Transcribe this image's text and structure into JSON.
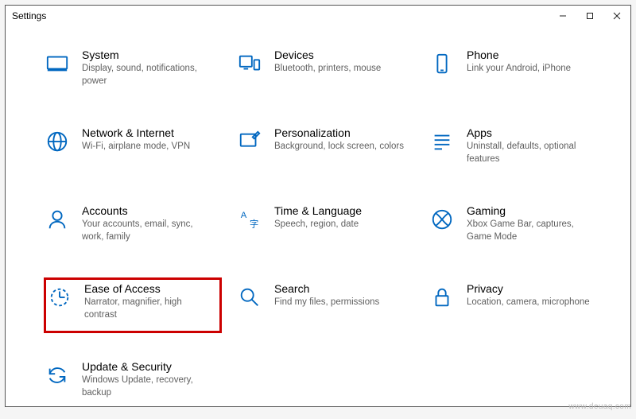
{
  "window": {
    "title": "Settings"
  },
  "tiles": [
    {
      "key": "system",
      "title": "System",
      "desc": "Display, sound, notifications, power"
    },
    {
      "key": "devices",
      "title": "Devices",
      "desc": "Bluetooth, printers, mouse"
    },
    {
      "key": "phone",
      "title": "Phone",
      "desc": "Link your Android, iPhone"
    },
    {
      "key": "network",
      "title": "Network & Internet",
      "desc": "Wi-Fi, airplane mode, VPN"
    },
    {
      "key": "personalization",
      "title": "Personalization",
      "desc": "Background, lock screen, colors"
    },
    {
      "key": "apps",
      "title": "Apps",
      "desc": "Uninstall, defaults, optional features"
    },
    {
      "key": "accounts",
      "title": "Accounts",
      "desc": "Your accounts, email, sync, work, family"
    },
    {
      "key": "timelang",
      "title": "Time & Language",
      "desc": "Speech, region, date"
    },
    {
      "key": "gaming",
      "title": "Gaming",
      "desc": "Xbox Game Bar, captures, Game Mode"
    },
    {
      "key": "ease",
      "title": "Ease of Access",
      "desc": "Narrator, magnifier, high contrast"
    },
    {
      "key": "search",
      "title": "Search",
      "desc": "Find my files, permissions"
    },
    {
      "key": "privacy",
      "title": "Privacy",
      "desc": "Location, camera, microphone"
    },
    {
      "key": "update",
      "title": "Update & Security",
      "desc": "Windows Update, recovery, backup"
    }
  ],
  "watermark": "www.deuaq.com"
}
